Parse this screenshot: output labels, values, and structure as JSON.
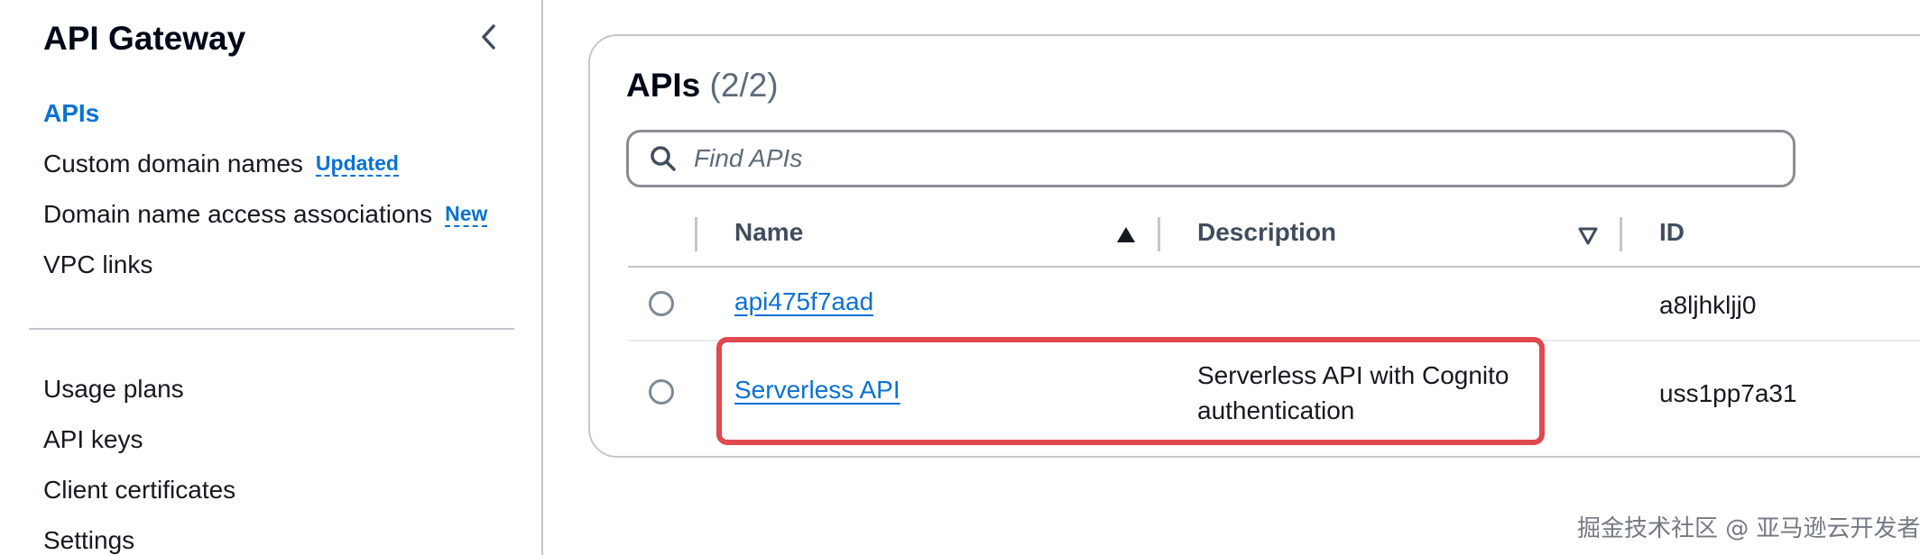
{
  "sidebar": {
    "title": "API Gateway",
    "collapse_icon": "chevron-left-icon",
    "items": [
      {
        "label": "APIs",
        "active": true
      },
      {
        "label": "Custom domain names",
        "badge": "Updated"
      },
      {
        "label": "Domain name access associations",
        "badge": "New"
      },
      {
        "label": "VPC links"
      },
      {
        "label": "Usage plans"
      },
      {
        "label": "API keys"
      },
      {
        "label": "Client certificates"
      },
      {
        "label": "Settings"
      }
    ]
  },
  "main": {
    "title": "APIs",
    "count": "(2/2)",
    "search": {
      "placeholder": "Find APIs",
      "value": "",
      "icon": "search-icon"
    },
    "table": {
      "columns": [
        {
          "label": "Name",
          "sort": "ascending",
          "sort_icon": "sort-ascending-icon"
        },
        {
          "label": "Description",
          "sort": "none",
          "sort_icon": "sort-descending-outline-icon"
        },
        {
          "label": "ID"
        }
      ],
      "rows": [
        {
          "name": "api475f7aad",
          "description_line1": "",
          "description_line2": "",
          "id": "a8ljhkljj0",
          "selected": false
        },
        {
          "name": "Serverless API",
          "description_line1": "Serverless API with Cognito",
          "description_line2": "authentication",
          "id": "uss1pp7a31",
          "selected": false,
          "highlighted": true
        }
      ]
    }
  },
  "colors": {
    "accent": "#0972d3",
    "highlight": "#e0494d",
    "border": "#c6c6cd"
  },
  "watermark": "掘金技术社区 @ 亚马逊云开发者"
}
